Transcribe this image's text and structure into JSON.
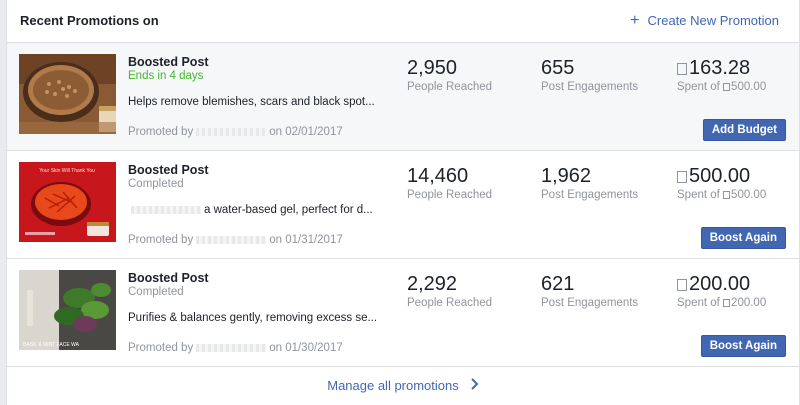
{
  "header": {
    "title": "Recent Promotions on",
    "create_label": "Create New Promotion"
  },
  "promotions": [
    {
      "type": "Boosted Post",
      "status": "Ends in 4 days",
      "description": "Helps remove blemishes, scars and black spot...",
      "promoted_prefix": "Promoted by",
      "promoted_suffix": "on 02/01/2017",
      "reach": "2,950",
      "reach_label": "People Reached",
      "engagements": "655",
      "engagements_label": "Post Engagements",
      "spent": "163.28",
      "spent_of_prefix": "Spent of",
      "spent_of": "500.00",
      "button": "Add Budget",
      "thumb_icon": "spice-bowl-image"
    },
    {
      "type": "Boosted Post",
      "status": "Completed",
      "description": "a water-based gel, perfect for d...",
      "promoted_prefix": "Promoted by",
      "promoted_suffix": "on 01/31/2017",
      "reach": "14,460",
      "reach_label": "People Reached",
      "engagements": "1,962",
      "engagements_label": "Post Engagements",
      "spent": "500.00",
      "spent_of_prefix": "Spent of",
      "spent_of": "500.00",
      "button": "Boost Again",
      "thumb_icon": "saffron-bowl-image",
      "thumb_text": "Your Skin Will Thank You"
    },
    {
      "type": "Boosted Post",
      "status": "Completed",
      "description": "Purifies & balances gently, removing excess se...",
      "promoted_prefix": "Promoted by",
      "promoted_suffix": "on 01/30/2017",
      "reach": "2,292",
      "reach_label": "People Reached",
      "engagements": "621",
      "engagements_label": "Post Engagements",
      "spent": "200.00",
      "spent_of_prefix": "Spent of",
      "spent_of": "200.00",
      "button": "Boost Again",
      "thumb_icon": "basil-mint-image",
      "thumb_text": "BASIL & MINT FACE WA"
    }
  ],
  "footer": {
    "manage_label": "Manage all promotions"
  },
  "colors": {
    "accent": "#4267b2",
    "green_status": "#42b72a",
    "muted": "#90949c"
  }
}
